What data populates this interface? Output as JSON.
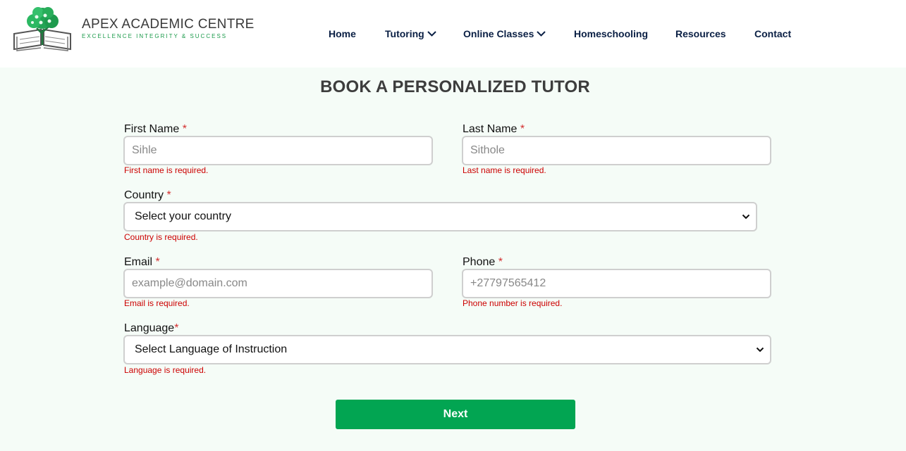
{
  "brand": {
    "name": "APEX ACADEMIC CENTRE",
    "tagline": "EXCELLENCE INTEGRITY & SUCCESS",
    "accent_color": "#1a9a4a",
    "logo_icon": "tree-book-logo-icon"
  },
  "nav": {
    "items": [
      {
        "label": "Home",
        "has_dropdown": false
      },
      {
        "label": "Tutoring",
        "has_dropdown": true
      },
      {
        "label": "Online Classes",
        "has_dropdown": true
      },
      {
        "label": "Homeschooling",
        "has_dropdown": false
      },
      {
        "label": "Resources",
        "has_dropdown": false
      },
      {
        "label": "Contact",
        "has_dropdown": false
      }
    ]
  },
  "form": {
    "title": "BOOK A PERSONALIZED TUTOR",
    "required_marker": "*",
    "first_name": {
      "label": "First Name",
      "placeholder": "Sihle",
      "error": "First name is required."
    },
    "last_name": {
      "label": "Last Name",
      "placeholder": "Sithole",
      "error": "Last name is required."
    },
    "country": {
      "label": "Country",
      "selected": "Select your country",
      "error": "Country is required."
    },
    "email": {
      "label": "Email",
      "placeholder": "example@domain.com",
      "error": "Email is required."
    },
    "phone": {
      "label": "Phone",
      "placeholder": "+27797565412",
      "error": "Phone number is required."
    },
    "language": {
      "label": "Language",
      "selected": "Select Language of Instruction",
      "error": "Language is required."
    },
    "next_label": "Next"
  },
  "colors": {
    "page_background": "#f5fcf7",
    "button": "#02a552",
    "error": "#cc0000",
    "nav_text": "#0a1f44"
  }
}
